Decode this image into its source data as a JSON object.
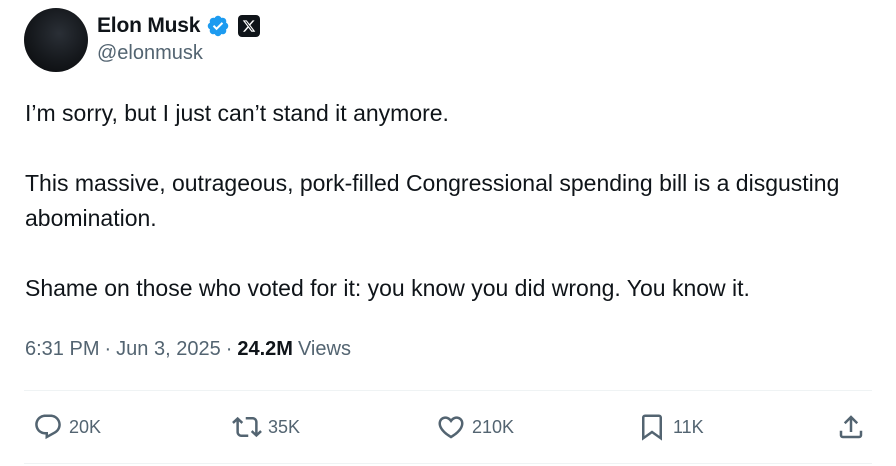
{
  "author": {
    "display_name": "Elon Musk",
    "handle": "@elonmusk",
    "verified": true,
    "affiliation_badge": "x-logo-icon"
  },
  "tweet": {
    "paragraphs": [
      "I’m sorry, but I just can’t stand it anymore.",
      "This massive, outrageous, pork-filled Congressional spending bill is a disgusting abomination.",
      "Shame on those who voted for it: you know you did wrong. You know it."
    ],
    "time": "6:31 PM",
    "separator": "·",
    "date": "Jun 3, 2025",
    "views_count": "24.2M",
    "views_label": "Views"
  },
  "actions": {
    "replies": "20K",
    "reposts": "35K",
    "likes": "210K",
    "bookmarks": "11K"
  },
  "colors": {
    "text": "#0f1419",
    "secondary": "#536471",
    "verified": "#1d9bf0",
    "divider": "#eff3f4"
  }
}
